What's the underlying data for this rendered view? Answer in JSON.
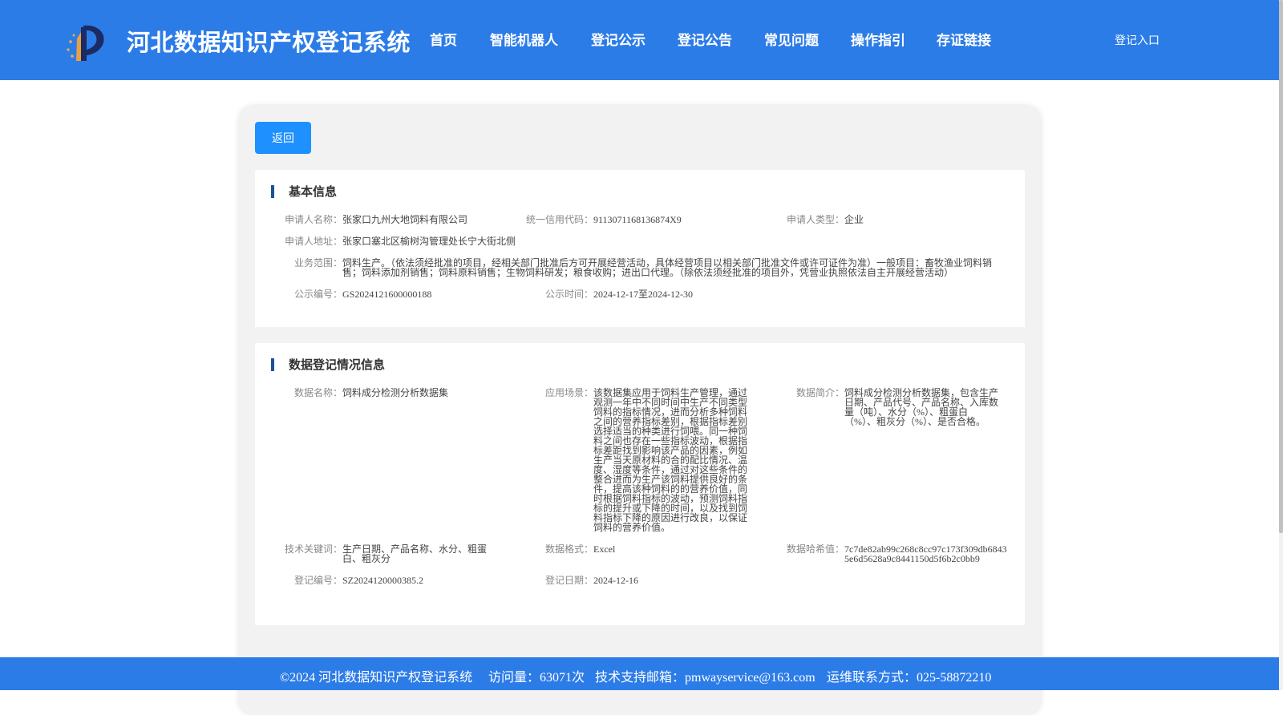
{
  "header": {
    "site_title": "河北数据知识产权登记系统",
    "nav": [
      {
        "id": "home",
        "label": "首页"
      },
      {
        "id": "robot",
        "label": "智能机器人"
      },
      {
        "id": "publicity",
        "label": "登记公示"
      },
      {
        "id": "announcement",
        "label": "登记公告"
      },
      {
        "id": "faq",
        "label": "常见问题"
      },
      {
        "id": "guide",
        "label": "操作指引"
      },
      {
        "id": "link",
        "label": "存证链接"
      }
    ],
    "login_label": "登记入口"
  },
  "panel": {
    "back_label": "返回",
    "basic": {
      "title": "基本信息",
      "applicant_name": {
        "label": "申请人名称：",
        "value": "张家口九州大地饲料有限公司"
      },
      "credit_code": {
        "label": "统一信用代码：",
        "value": "9113071168136874X9"
      },
      "applicant_type": {
        "label": "申请人类型：",
        "value": "企业"
      },
      "address": {
        "label": "申请人地址：",
        "value": "张家口塞北区榆树沟管理处长宁大街北侧"
      },
      "business_scope": {
        "label": "业务范围：",
        "value": "饲料生产。（依法须经批准的项目，经相关部门批准后方可开展经营活动，具体经营项目以相关部门批准文件或许可证件为准）一般项目：畜牧渔业饲料销售；饲料添加剂销售；饲料原料销售；生物饲料研发；粮食收购；进出口代理。（除依法须经批准的项目外，凭营业执照依法自主开展经营活动）"
      },
      "publicity_no": {
        "label": "公示编号：",
        "value": "GS2024121600000188"
      },
      "publicity_time": {
        "label": "公示时间：",
        "value": "2024-12-17至2024-12-30"
      }
    },
    "data_reg": {
      "title": "数据登记情况信息",
      "data_name": {
        "label": "数据名称：",
        "value": "饲料成分检测分析数据集"
      },
      "scenario": {
        "label": "应用场景：",
        "value": "该数据集应用于饲料生产管理，通过观测一年中不同时间中生产不同类型饲料的指标情况，进而分析多种饲料之间的营养指标差别，根据指标差别选择适当的种类进行饲喂。同一种饲料之间也存在一些指标波动，根据指标差距找到影响该产品的因素，例如生产当天原材料的合的配比情况、温度、湿度等条件，通过对这些条件的整合进而为生产该饲料提供良好的条件，提高该种饲料的的营养价值，同时根据饲料指标的波动，预测饲料指标的提升或下降的时间，以及找到饲料指标下降的原因进行改良，以保证饲料的营养价值。"
      },
      "summary": {
        "label": "数据简介：",
        "value": "饲料成分检测分析数据集，包含生产日期、产品代号、产品名称、入库数量（吨）、水分（%）、粗蛋白（%）、粗灰分（%）、是否合格。"
      },
      "keywords": {
        "label": "技术关键词：",
        "value": "生产日期、产品名称、水分、粗蛋白、粗灰分"
      },
      "format": {
        "label": "数据格式：",
        "value": "Excel"
      },
      "hash": {
        "label": "数据哈希值：",
        "value": "7c7de82ab99c268c8cc97c173f309db68435e6d5628a9c8441150d5f6b2c0bb9"
      },
      "reg_no": {
        "label": "登记编号：",
        "value": "SZ2024120000385.2"
      },
      "reg_date": {
        "label": "登记日期：",
        "value": "2024-12-16"
      }
    }
  },
  "footer": {
    "copyright": "©2024 河北数据知识产权登记系统",
    "visits": "访问量：63071次",
    "email": "技术支持邮箱：pmwayservice@163.com",
    "phone": "运维联系方式：025-58872210"
  },
  "colors": {
    "header_bg": "#2c7ce8",
    "button_bg": "#1e90ff",
    "title_bar": "#1f4f9c"
  }
}
